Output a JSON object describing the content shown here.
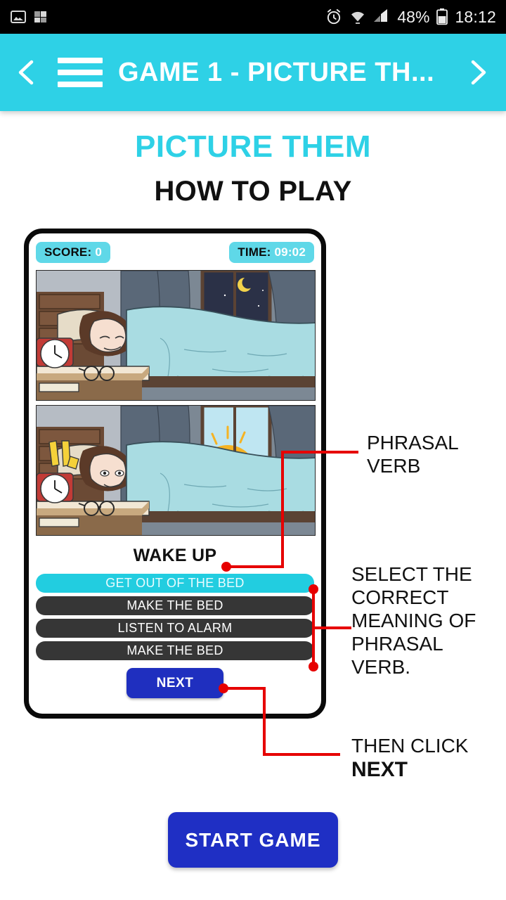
{
  "statusbar": {
    "icons": [
      "photo-icon",
      "signal-bars-icon",
      "alarm-icon",
      "wifi-icon",
      "cell-signal-icon",
      "battery-icon"
    ],
    "battery_percent": "48%",
    "time": "18:12"
  },
  "appbar": {
    "title": "GAME 1 - PICTURE TH...",
    "back_icon": "chevron-left-icon",
    "menu_icon": "hamburger-menu-icon",
    "forward_icon": "chevron-right-icon",
    "background_color": "#2ed1e6"
  },
  "page": {
    "title": "PICTURE THEM",
    "subtitle": "HOW TO PLAY",
    "title_color": "#2ed1e6"
  },
  "mockup": {
    "score_label": "SCORE:",
    "score_value": "0",
    "time_label": "TIME:",
    "time_value": "09:02",
    "panel_top_alt": "Night scene: person sleeping in bed, crescent moon through window, alarm clock and glasses on nightstand",
    "panel_bottom_alt": "Morning scene: sun rising through window, alarm clock ringing, person awake in bed",
    "prompt": "WAKE UP",
    "options": [
      {
        "label": "GET OUT OF THE BED",
        "selected": true
      },
      {
        "label": "MAKE THE BED",
        "selected": false
      },
      {
        "label": "LISTEN TO ALARM",
        "selected": false
      },
      {
        "label": "MAKE THE BED",
        "selected": false
      }
    ],
    "next_label": "NEXT",
    "selected_color": "#22cde0",
    "option_color": "#363636",
    "next_color": "#1f2fbf"
  },
  "annotations": {
    "phrasal_verb": "PHRASAL\nVERB",
    "phrasal_verb_line1": "PHRASAL",
    "phrasal_verb_line2": "VERB",
    "select_meaning": "SELECT THE CORRECT MEANING OF PHRASAL VERB.",
    "then_click": "THEN CLICK",
    "then_click_bold": "NEXT",
    "leader_color": "#e60000"
  },
  "start": {
    "label": "START GAME",
    "color": "#1f2fc4"
  }
}
